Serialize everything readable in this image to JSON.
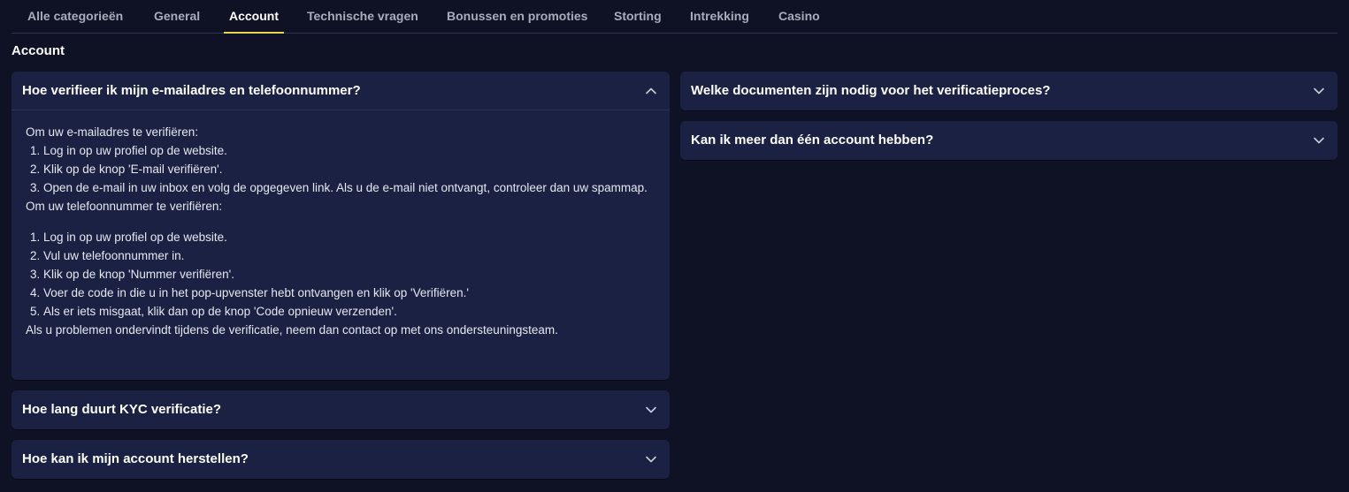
{
  "tabs": [
    {
      "label": "Alle categorieën",
      "active": false
    },
    {
      "label": "General",
      "active": false
    },
    {
      "label": "Account",
      "active": true
    },
    {
      "label": "Technische vragen",
      "active": false
    },
    {
      "label": "Bonussen en promoties",
      "active": false
    },
    {
      "label": "Storting",
      "active": false
    },
    {
      "label": "Intrekking",
      "active": false
    },
    {
      "label": "Casino",
      "active": false
    }
  ],
  "section_title": "Account",
  "faq": {
    "q1": {
      "title": "Hoe verifieer ik mijn e-mailadres en telefoonnummer?",
      "expanded": true,
      "email_intro": "Om uw e-mailadres te verifiëren:",
      "email_steps": [
        "Log in op uw profiel op de website.",
        "Klik op de knop 'E-mail verifiëren'.",
        "Open de e-mail in uw inbox en volg de opgegeven link. Als u de e-mail niet ontvangt, controleer dan uw spammap."
      ],
      "phone_intro": "Om uw telefoonnummer te verifiëren:",
      "phone_steps": [
        "Log in op uw profiel op de website.",
        "Vul uw telefoonnummer in.",
        "Klik op de knop 'Nummer verifiëren'.",
        "Voer de code in die u in het pop-upvenster hebt ontvangen en klik op 'Verifiëren.'",
        "Als er iets misgaat, klik dan op de knop 'Code opnieuw verzenden'."
      ],
      "outro": "Als u problemen ondervindt tijdens de verificatie, neem dan contact op met ons ondersteuningsteam."
    },
    "q2": {
      "title": "Hoe lang duurt KYC verificatie?",
      "expanded": false
    },
    "q3": {
      "title": "Hoe kan ik mijn account herstellen?",
      "expanded": false
    },
    "q4": {
      "title": "Welke documenten zijn nodig voor het verificatieproces?",
      "expanded": false
    },
    "q5": {
      "title": "Kan ik meer dan één account hebben?",
      "expanded": false
    }
  },
  "icons": {
    "chevron_up": "chevron-up-icon",
    "chevron_down": "chevron-down-icon"
  },
  "colors": {
    "background": "#0f1125",
    "card": "#1a2142",
    "active_tab_underline": "#e7d44b",
    "tab_inactive": "#a8acbb"
  }
}
